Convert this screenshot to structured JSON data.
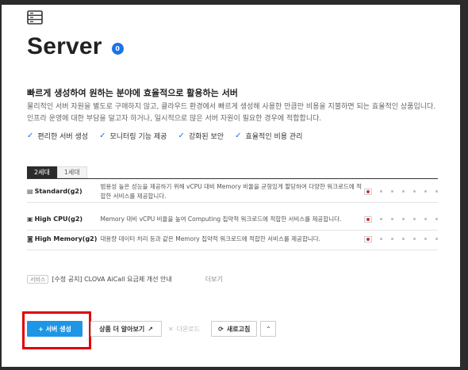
{
  "page": {
    "title": "Server",
    "server_count": "0",
    "heading": "빠르게 생성하여 원하는 분야에 효율적으로 활용하는 서버",
    "description_line1": "물리적인 서버 자원을 별도로 구매하지 않고, 클라우드 환경에서 빠르게 생성해 사용한 만큼만 비용을 지불하면 되는 효율적인 상품입니다.",
    "description_line2": "인프라 운영에 대한 부담을 덜고자 하거나, 일시적으로 많은 서버 자원이 필요한 경우에 적합합니다."
  },
  "features": [
    {
      "label": "편리한 서버 생성"
    },
    {
      "label": "모니터링 기능 제공"
    },
    {
      "label": "강화된 보안"
    },
    {
      "label": "효율적인 비용 관리"
    }
  ],
  "tabs": [
    {
      "label": "2세대",
      "active": true
    },
    {
      "label": "1세대",
      "active": false
    }
  ],
  "server_types": [
    {
      "name": "Standard(g2)",
      "icon": "server-rack-icon",
      "glyph": "▤",
      "description": "범용성 높은 성능을 제공하기 위해 vCPU 대비 Memory 비율을 균형있게 할당하여 다양한 워크로드에 적합한 서비스를 제공합니다."
    },
    {
      "name": "High CPU(g2)",
      "icon": "cpu-icon",
      "glyph": "▣",
      "description": "Memory 대비 vCPU 비율을 높여 Computing 집약적 워크로드에 적합한 서비스를 제공합니다."
    },
    {
      "name": "High Memory(g2)",
      "icon": "memory-icon",
      "glyph": "◙",
      "description": "대용량 데이터 처리 등과 같은 Memory 집약적 워크로드에 적합한 서비스를 제공합니다."
    }
  ],
  "notice": {
    "badge": "서비스",
    "text": "[수정 공지] CLOVA AiCall 요금제 개선 안내",
    "more": "더보기"
  },
  "buttons": {
    "create": "+ 서버 생성",
    "learn_more": "상품 더 알아보기",
    "learn_more_icon": "external-link-icon",
    "download": "다운로드",
    "download_icon": "close-icon",
    "refresh": "새로고침",
    "refresh_icon": "refresh-icon",
    "collapse_icon": "chevron-up-icon"
  },
  "colors": {
    "primary": "#1e96e6",
    "badge": "#1a73e8",
    "highlight": "#e00000"
  }
}
